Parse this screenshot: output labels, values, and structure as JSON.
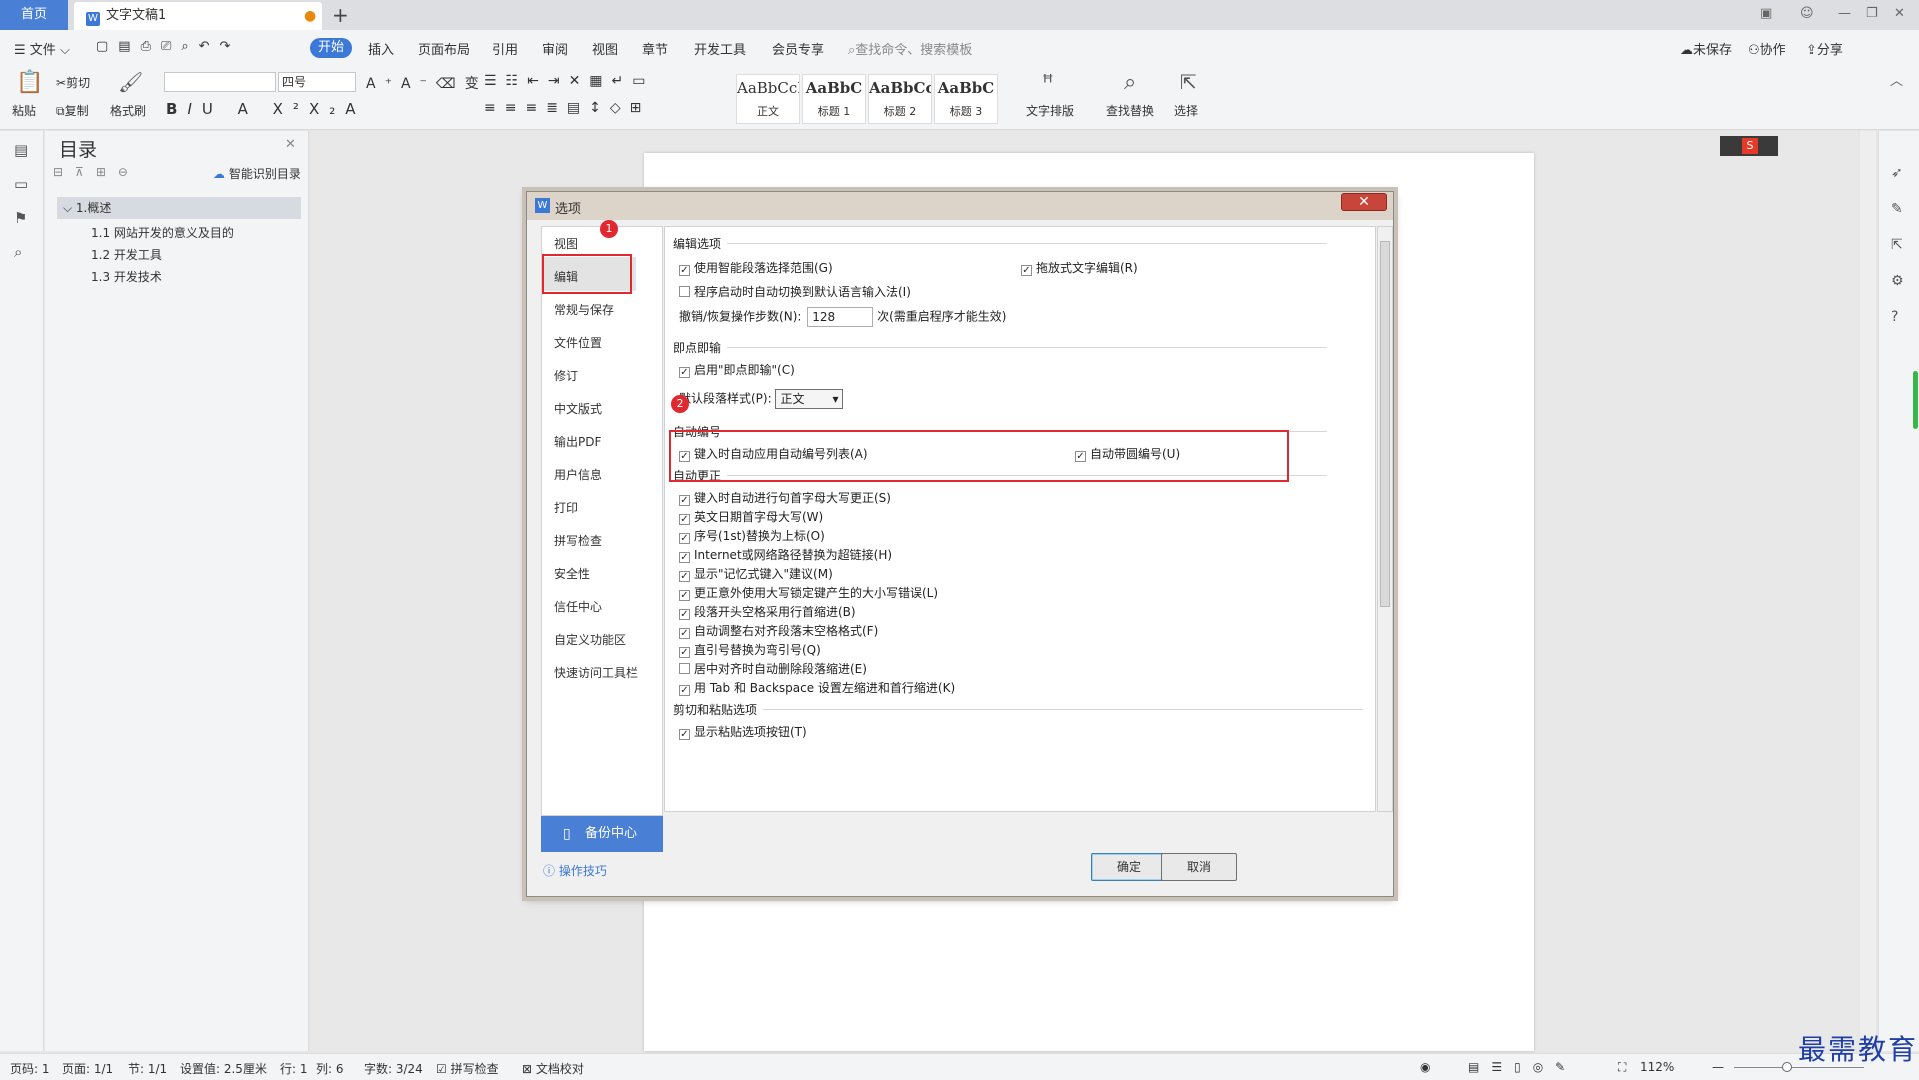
{
  "tabs": {
    "home": "首页",
    "doc": "文字文稿1",
    "add": "+"
  },
  "menu": {
    "file": "文件",
    "items": [
      "开始",
      "插入",
      "页面布局",
      "引用",
      "审阅",
      "视图",
      "章节",
      "开发工具",
      "会员专享"
    ],
    "search": "查找命令、搜索模板",
    "unsaved": "未保存",
    "collab": "协作",
    "share": "分享"
  },
  "ribbon": {
    "paste": "粘贴",
    "cut": "剪切",
    "copy": "复制",
    "format_painter": "格式刷",
    "font_size": "四号",
    "styles": [
      {
        "sample": "AaBbCcI",
        "name": "正文"
      },
      {
        "sample": "AaBbC",
        "name": "标题 1"
      },
      {
        "sample": "AaBbCc",
        "name": "标题 2"
      },
      {
        "sample": "AaBbC",
        "name": "标题 3"
      }
    ],
    "text_layout": "文字排版",
    "find_replace": "查找替换",
    "select": "选择"
  },
  "toc": {
    "title": "目录",
    "smart": "智能识别目录",
    "items": [
      "1.概述",
      "1.1 网站开发的意义及目的",
      "1.2 开发工具",
      "1.3 开发技术"
    ]
  },
  "dialog": {
    "title": "选项",
    "nav": [
      "视图",
      "编辑",
      "常规与保存",
      "文件位置",
      "修订",
      "中文版式",
      "输出PDF",
      "用户信息",
      "打印",
      "拼写检查",
      "安全性",
      "信任中心",
      "自定义功能区",
      "快速访问工具栏"
    ],
    "backup": "备份中心",
    "tips": "操作技巧",
    "ok": "确定",
    "cancel": "取消",
    "sections": {
      "edit": "编辑选项",
      "click_input": "即点即输",
      "autonum": "自动编号",
      "autocorrect": "自动更正",
      "cutpaste": "剪切和粘贴选项"
    },
    "edit_opts": {
      "smart_para": "使用智能段落选择范围(G)",
      "drag_edit": "拖放式文字编辑(R)",
      "auto_ime": "程序启动时自动切换到默认语言输入法(I)",
      "undo_label": "撤销/恢复操作步数(N):",
      "undo_value": "128",
      "undo_suffix": "次(需重启程序才能生效)"
    },
    "click_opts": {
      "enable": "启用\"即点即输\"(C)",
      "default_style_label": "默认段落样式(P):",
      "default_style_value": "正文"
    },
    "autonum_opts": {
      "auto_list": "键入时自动应用自动编号列表(A)",
      "circle_num": "自动带圆编号(U)"
    },
    "autocorrect_opts": [
      "键入时自动进行句首字母大写更正(S)",
      "英文日期首字母大写(W)",
      "序号(1st)替换为上标(O)",
      "Internet或网络路径替换为超链接(H)",
      "显示\"记忆式键入\"建议(M)",
      "更正意外使用大写锁定键产生的大小写错误(L)",
      "段落开头空格采用行首缩进(B)",
      "自动调整右对齐段落末空格格式(F)",
      "直引号替换为弯引号(Q)",
      "居中对齐时自动删除段落缩进(E)",
      "用 Tab 和 Backspace 设置左缩进和首行缩进(K)"
    ],
    "autocorrect_checked": [
      true,
      true,
      true,
      true,
      true,
      true,
      true,
      true,
      true,
      false,
      true
    ],
    "paste_opts": {
      "show_btn": "显示粘贴选项按钮(T)"
    }
  },
  "annotations": {
    "one": "1",
    "two": "2"
  },
  "status": {
    "page": "页码: 1",
    "pages": "页面: 1/1",
    "section": "节: 1/1",
    "setting": "设置值: 2.5厘米",
    "row": "行: 1",
    "col": "列: 6",
    "words": "字数: 3/24",
    "spell": "拼写检查",
    "proof": "文档校对",
    "zoom": "112%"
  },
  "watermark": "最需教育"
}
